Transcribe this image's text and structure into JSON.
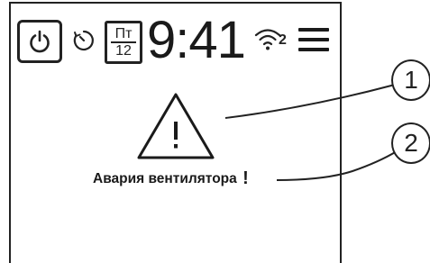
{
  "status_bar": {
    "power_icon": "power-icon",
    "timer_icon": "timer-icon",
    "date": {
      "day": "Пт",
      "number": "12"
    },
    "time": "9:41",
    "wifi_icon": "wifi-icon",
    "wifi_index": "2",
    "menu_icon": "hamburger-menu-icon"
  },
  "alarm": {
    "icon": "warning-triangle-icon",
    "message": "Авария вентилятора",
    "mark": "!"
  },
  "callouts": [
    {
      "label": "1"
    },
    {
      "label": "2"
    }
  ],
  "colors": {
    "ink": "#1a1a1a",
    "background": "#ffffff"
  }
}
